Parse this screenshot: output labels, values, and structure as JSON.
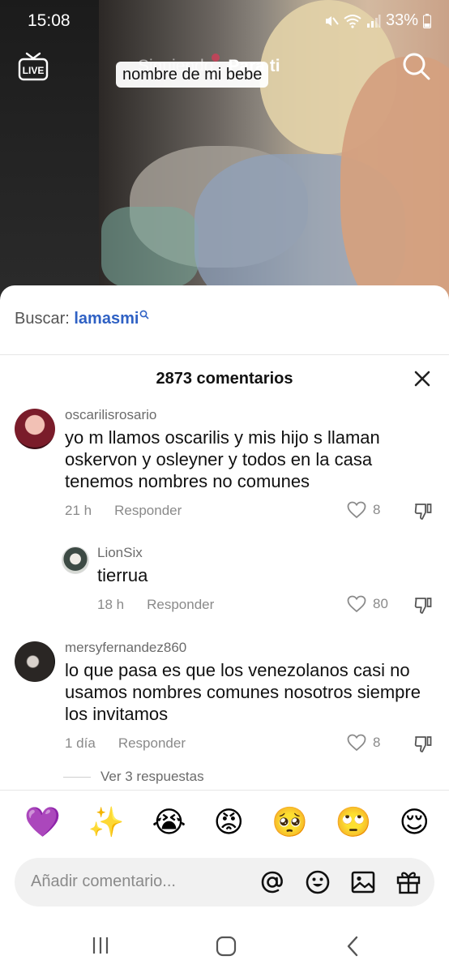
{
  "status_bar": {
    "time": "15:08",
    "battery": "33%"
  },
  "top_nav": {
    "live_label": "LIVE",
    "tabs": [
      {
        "label": "Siguiendo"
      },
      {
        "label": "Para ti"
      }
    ],
    "overlay_caption": "nombre de mi bebe"
  },
  "sheet": {
    "search_prefix": "Buscar:",
    "search_query": "lamasmi",
    "comments_count_label": "2873 comentarios",
    "comments": [
      {
        "user": "oscarilisrosario",
        "text": "yo m llamos oscarilis y mis hijo s llaman oskervon y osleyner y todos en la casa tenemos nombres no comunes",
        "time": "21 h",
        "reply_label": "Responder",
        "likes": "8"
      },
      {
        "user": "LionSix",
        "text": "tierrua",
        "time": "18 h",
        "reply_label": "Responder",
        "likes": "80"
      },
      {
        "user": "mersyfernandez860",
        "text": "lo que pasa es que los venezolanos casi no usamos nombres comunes nosotros siempre los invitamos",
        "time": "1 día",
        "reply_label": "Responder",
        "likes": "8"
      }
    ],
    "view_replies": "Ver 3 respuestas",
    "emojis": [
      "💜",
      "✨",
      "😭",
      "😡",
      "🥺",
      "🙄",
      "😌"
    ],
    "composer_placeholder": "Añadir comentario..."
  },
  "colors": {
    "accent_link": "#2f61c4",
    "live_dot": "#ff2d55"
  }
}
